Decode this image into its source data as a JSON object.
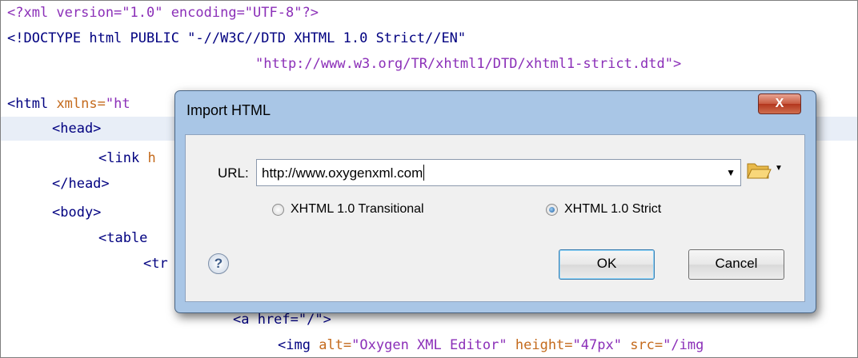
{
  "editor": {
    "lines": {
      "l1": {
        "text": "<?xml version=\"1.0\" encoding=\"UTF-8\"?>"
      },
      "l2": {
        "text": "<!DOCTYPE html PUBLIC \"-//W3C//DTD XHTML 1.0 Strict//EN\""
      },
      "l3": {
        "text": "\"http://www.w3.org/TR/xhtml1/DTD/xhtml1-strict.dtd\">"
      },
      "l4": {
        "tag": "<html",
        "attr": "xmlns=",
        "val": "\"ht"
      },
      "l5": {
        "text": "<head>"
      },
      "l6": {
        "tag": "<link",
        "attr": "h"
      },
      "l7": {
        "text": "</head>"
      },
      "l8": {
        "text": "<body>"
      },
      "l9": {
        "text": "<table"
      },
      "l10": {
        "text": "<tr"
      },
      "l11": {
        "text": "<a href=\"/\">"
      },
      "l12": {
        "tag": "<img",
        "a1": "alt=",
        "v1": "\"Oxygen XML Editor\"",
        "a2": "height=",
        "v2": "\"47px\"",
        "a3": "src=",
        "v3": "\"/img"
      }
    }
  },
  "dialog": {
    "title": "Import HTML",
    "close_label": "X",
    "url_label": "URL:",
    "url_value": "http://www.oxygenxml.com",
    "radio_transitional": "XHTML 1.0 Transitional",
    "radio_strict": "XHTML 1.0 Strict",
    "selected_option": "XHTML 1.0 Strict",
    "help_label": "?",
    "ok_label": "OK",
    "cancel_label": "Cancel"
  },
  "icons": {
    "browse": "folder-open-icon",
    "dropdown": "chevron-down-icon",
    "help": "help-icon",
    "close": "close-icon"
  },
  "colors": {
    "tag": "#000080",
    "attribute": "#c46a1c",
    "string": "#8b2fb8",
    "dialog_frame": "#a9c6e6",
    "close_button": "#c85a40"
  }
}
